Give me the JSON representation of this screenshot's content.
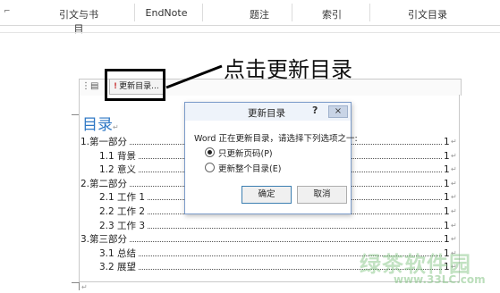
{
  "ribbon": {
    "tabs": [
      "引文与书目",
      "EndNote",
      "题注",
      "索引",
      "引文目录"
    ]
  },
  "toolbar": {
    "update_label": "更新目录..."
  },
  "annotation": {
    "callout": "点击更新目录"
  },
  "toc": {
    "title": "目录",
    "entries": [
      {
        "text": "1.第一部分",
        "page": "1",
        "level": 1
      },
      {
        "text": "1.1 背景",
        "page": "1",
        "level": 2
      },
      {
        "text": "1.2 意义",
        "page": "1",
        "level": 2
      },
      {
        "text": "2.第二部分",
        "page": "1",
        "level": 1
      },
      {
        "text": "2.1 工作 1",
        "page": "1",
        "level": 2
      },
      {
        "text": "2.2 工作 2",
        "page": "1",
        "level": 2
      },
      {
        "text": "2.3 工作 3",
        "page": "1",
        "level": 2
      },
      {
        "text": "3.第三部分",
        "page": "1",
        "level": 1
      },
      {
        "text": "3.1 总结",
        "page": "1",
        "level": 2
      },
      {
        "text": "3.2 展望",
        "page": "1",
        "level": 2
      }
    ]
  },
  "dialog": {
    "title": "更新目录",
    "help": "?",
    "close": "×",
    "prompt": "Word 正在更新目录，请选择下列选项之一:",
    "options": [
      {
        "label": "只更新页码(P)",
        "selected": true
      },
      {
        "label": "更新整个目录(E)",
        "selected": false
      }
    ],
    "ok": "确定",
    "cancel": "取消"
  },
  "watermark": {
    "brand": "绿茶软件园",
    "url": "www.33LC.com"
  },
  "colors": {
    "toc_title": "#2f78c5",
    "dialog_border": "#7b9bc9"
  }
}
